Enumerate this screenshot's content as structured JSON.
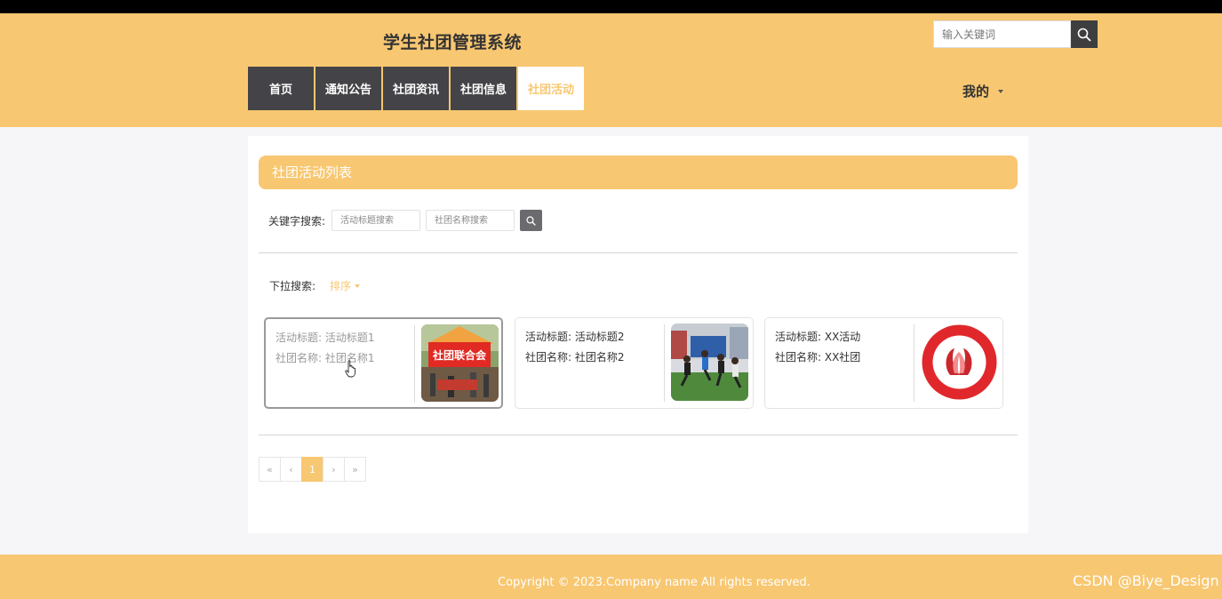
{
  "header": {
    "title": "学生社团管理系统",
    "search_placeholder": "输入关键词",
    "my_label": "我的"
  },
  "nav": {
    "items": [
      {
        "label": "首页"
      },
      {
        "label": "通知公告"
      },
      {
        "label": "社团资讯"
      },
      {
        "label": "社团信息"
      },
      {
        "label": "社团活动",
        "active": true
      }
    ]
  },
  "main": {
    "list_title": "社团活动列表",
    "keyword_label": "关键字搜索:",
    "title_placeholder": "活动标题搜索",
    "club_placeholder": "社团名称搜索",
    "dropdown_label": "下拉搜索:",
    "sort_label": "排序"
  },
  "cards": [
    {
      "title": "活动标题: 活动标题1",
      "club": "社团名称: 社团名称1",
      "image": "club-fair-tent-photo"
    },
    {
      "title": "活动标题: 活动标题2",
      "club": "社团名称: 社团名称2",
      "image": "students-jumping-photo"
    },
    {
      "title": "活动标题: XX活动",
      "club": "社团名称: XX社团",
      "image": "union-of-association-logo"
    }
  ],
  "pagination": {
    "first": "«",
    "prev": "‹",
    "current": "1",
    "next": "›",
    "last": "»"
  },
  "footer": {
    "copyright": "Copyright © 2023.Company name All rights reserved.",
    "watermark": "CSDN @Biye_Design"
  },
  "colors": {
    "brand": "#f8c771",
    "nav_dark": "#444347",
    "page_bg": "#f6f5f8"
  },
  "icons": [
    "search-icon",
    "chevron-down-icon",
    "cursor-hand-icon"
  ]
}
